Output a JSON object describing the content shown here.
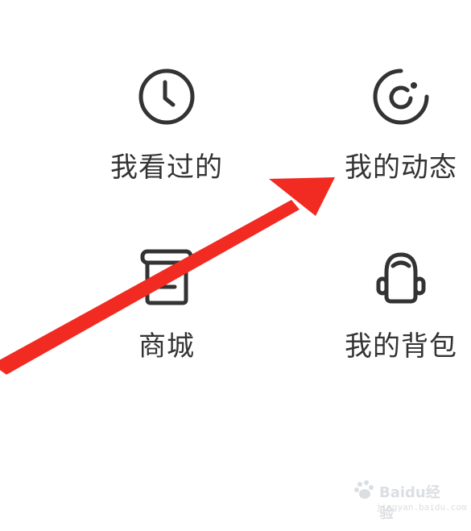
{
  "menu": {
    "items": [
      {
        "label": "我看过的",
        "icon": "clock-icon"
      },
      {
        "label": "我的动态",
        "icon": "activity-refresh-icon"
      },
      {
        "label": "商城",
        "icon": "shop-icon"
      },
      {
        "label": "我的背包",
        "icon": "backpack-icon"
      }
    ]
  },
  "annotation": {
    "arrow_color": "#f12a22"
  },
  "watermark": {
    "brand": "Baidu经验",
    "url": "jingyan.baidu.com"
  },
  "colors": {
    "icon_stroke": "#333333",
    "text": "#333333",
    "background": "#ffffff"
  }
}
